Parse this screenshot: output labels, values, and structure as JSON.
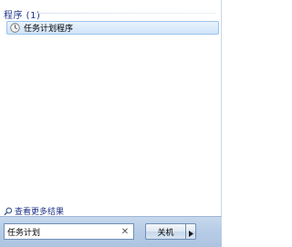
{
  "results": {
    "group_header": "程序 (1)",
    "items": [
      {
        "label": "任务计划程序",
        "icon": "clock-icon"
      }
    ],
    "see_more": {
      "label": "查看更多结果",
      "icon": "search-icon"
    }
  },
  "search": {
    "value": "任务计划",
    "clear_icon": "close-icon"
  },
  "shutdown": {
    "label": "关机",
    "arrow_icon": "right-arrow-icon"
  },
  "colors": {
    "header_text": "#1e3287",
    "highlight_border": "#9ac4eb",
    "bottom_bar": "#b8cde6"
  }
}
